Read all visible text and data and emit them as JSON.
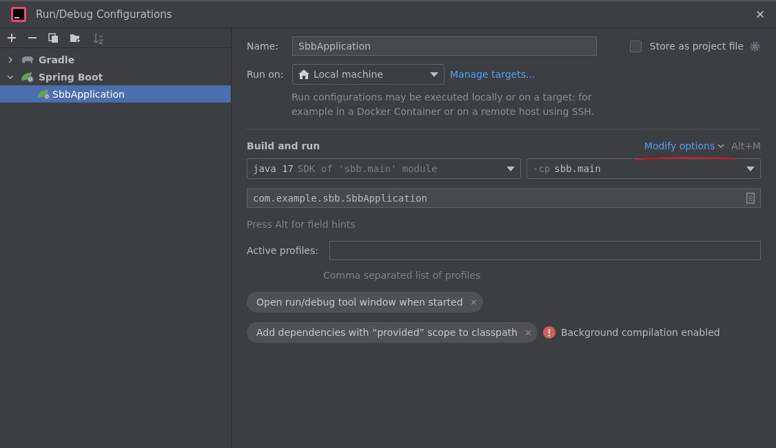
{
  "window": {
    "title": "Run/Debug Configurations",
    "close": "✕"
  },
  "toolbar": {
    "sort_enabled": false
  },
  "tree": [
    {
      "label": "Gradle",
      "kind": "gradle",
      "expanded": false,
      "selected": false
    },
    {
      "label": "Spring Boot",
      "kind": "spring",
      "expanded": true,
      "selected": false,
      "children": [
        {
          "label": "SbbApplication",
          "kind": "spring",
          "selected": true
        }
      ]
    }
  ],
  "name": {
    "label": "Name:",
    "value": "SbbApplication"
  },
  "store_as_project_file": {
    "label": "Store as project file",
    "checked": false
  },
  "run_on": {
    "label": "Run on:",
    "value": "Local machine",
    "link": "Manage targets...",
    "hint": "Run configurations may be executed locally or on a target: for example in a Docker Container or on a remote host using SSH."
  },
  "build_and_run": {
    "title": "Build and run",
    "modify_link": "Modify options",
    "shortcut": "Alt+M",
    "jre": {
      "value": "java 17",
      "detail": "SDK of 'sbb.main' module"
    },
    "classpath": {
      "prefix": "-cp",
      "value": "sbb.main"
    },
    "main_class": "com.example.sbb.SbbApplication"
  },
  "field_hint": "Press Alt for field hints",
  "active_profiles": {
    "label": "Active profiles:",
    "hint": "Comma separated list of profiles"
  },
  "options": [
    {
      "label": "Open run/debug tool window when started",
      "close": "✕"
    },
    {
      "label": "Add dependencies with “provided” scope to classpath",
      "close": "✕"
    }
  ],
  "warning": "Background compilation enabled"
}
